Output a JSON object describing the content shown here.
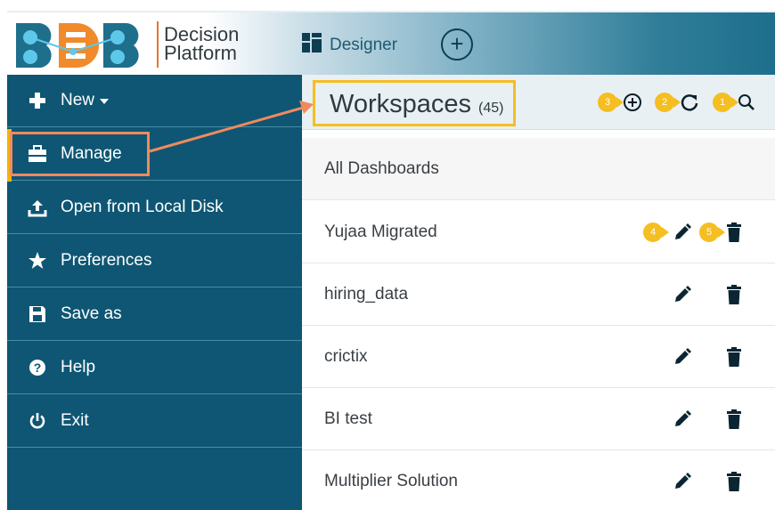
{
  "header": {
    "brand_line1": "Decision",
    "brand_line2": "Platform",
    "designer_label": "Designer",
    "add_symbol": "+"
  },
  "sidebar": {
    "items": [
      {
        "label": "New",
        "icon": "plus-icon",
        "has_caret": true
      },
      {
        "label": "Manage",
        "icon": "briefcase-icon"
      },
      {
        "label": "Open from Local Disk",
        "icon": "upload-icon"
      },
      {
        "label": "Preferences",
        "icon": "star-icon"
      },
      {
        "label": "Save as",
        "icon": "save-icon"
      },
      {
        "label": "Help",
        "icon": "help-icon"
      },
      {
        "label": "Exit",
        "icon": "power-icon"
      }
    ]
  },
  "workspaces": {
    "title": "Workspaces",
    "count": "(45)",
    "header_badges": [
      "3",
      "2",
      "1"
    ],
    "row_badges": [
      "4",
      "5"
    ],
    "rows": [
      {
        "name": "All Dashboards"
      },
      {
        "name": "Yujaa Migrated"
      },
      {
        "name": "hiring_data"
      },
      {
        "name": "crictix"
      },
      {
        "name": "BI test"
      },
      {
        "name": "Multiplier Solution"
      }
    ]
  },
  "colors": {
    "sidebar_bg": "#0e5673",
    "highlight_yellow": "#f5be21",
    "highlight_orange": "#f08a5d",
    "accent_orange": "#e3782f"
  }
}
